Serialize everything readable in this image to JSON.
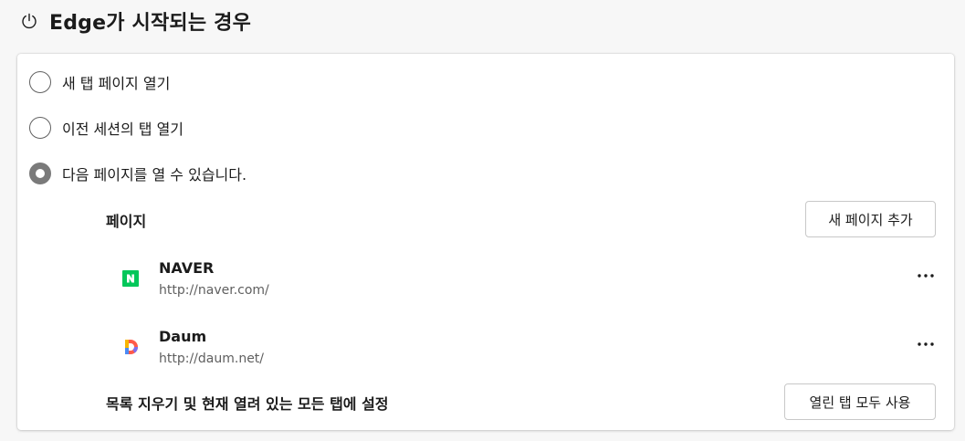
{
  "header": {
    "title": "Edge가 시작되는 경우",
    "icon": "power-icon"
  },
  "options": [
    {
      "label": "새 탭 페이지 열기",
      "checked": false
    },
    {
      "label": "이전 세션의 탭 열기",
      "checked": false
    },
    {
      "label": "다음 페이지를 열 수 있습니다.",
      "checked": true
    }
  ],
  "pages_section": {
    "label": "페이지",
    "add_button": "새 페이지 추가",
    "items": [
      {
        "name": "NAVER",
        "url": "http://naver.com/",
        "icon": "naver-favicon",
        "color": "#03c75a"
      },
      {
        "name": "Daum",
        "url": "http://daum.net/",
        "icon": "daum-favicon",
        "color": "#ff5a4a"
      }
    ],
    "more_icon": "more-icon"
  },
  "footer": {
    "label": "목록 지우기 및 현재 열려 있는 모든 탭에 설정",
    "button": "열린 탭 모두 사용"
  }
}
